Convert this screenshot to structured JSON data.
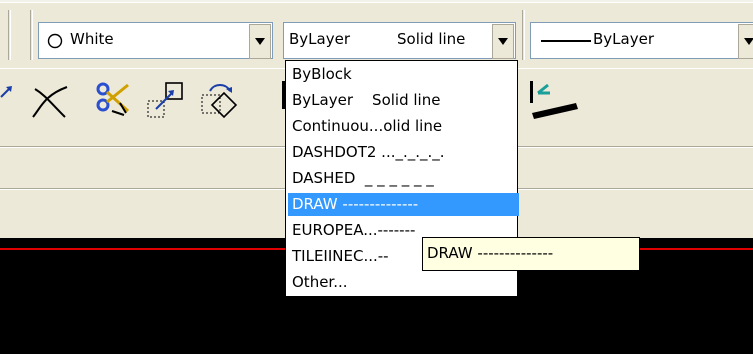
{
  "toolbar": {
    "color_combo": {
      "value": "White",
      "icon": "circle-outline-icon"
    },
    "linetype_combo": {
      "name": "ByLayer",
      "desc": "Solid line"
    },
    "lineweight_combo": {
      "value": "ByLayer",
      "icon": "line-sample-icon"
    }
  },
  "linetype_menu": {
    "items": [
      {
        "label": "ByBlock"
      },
      {
        "label": "ByLayer    Solid line"
      },
      {
        "label": "Continuou...olid line"
      },
      {
        "label": "DASHDOT2 ..._._._._."
      },
      {
        "label": "DASHED  _ _ _ _ _ _"
      },
      {
        "label": "DRAW --------------"
      },
      {
        "label": "EUROPEA...-------"
      },
      {
        "label": "TILEIINEC...--"
      },
      {
        "label": "Other..."
      }
    ],
    "selected_index": 5
  },
  "tooltip": {
    "text": "DRAW --------------"
  },
  "colors": {
    "selection": "#3399ff",
    "canvas": "#000000",
    "guide_line": "#e00000",
    "tooltip_bg": "#ffffe1"
  },
  "modify_toolbar_icons": [
    "arrow-icon",
    "trim-icon",
    "break-icon",
    "stretch-icon",
    "rotate-icon",
    "match-properties-icon"
  ]
}
